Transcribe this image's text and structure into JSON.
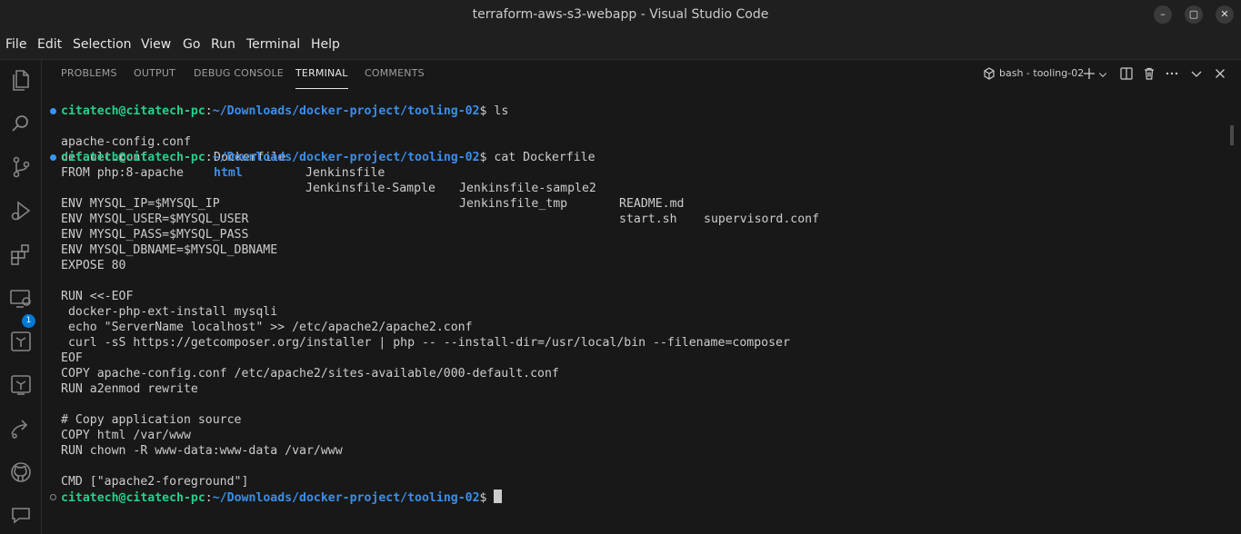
{
  "window": {
    "title": "terraform-aws-s3-webapp - Visual Studio Code",
    "controls": {
      "minimize": "–",
      "maximize": "▢",
      "close": "✕"
    }
  },
  "menu": [
    "File",
    "Edit",
    "Selection",
    "View",
    "Go",
    "Run",
    "Terminal",
    "Help"
  ],
  "activity_bar": {
    "icons": [
      "explorer-icon",
      "search-icon",
      "source-control-icon",
      "run-debug-icon",
      "extensions-icon",
      "remote-explorer-icon",
      "terraform-icon",
      "terraform-cloud-icon",
      "share-icon",
      "github-icon",
      "comments-icon"
    ],
    "extensions_badge": "1"
  },
  "panel": {
    "tabs": [
      "PROBLEMS",
      "OUTPUT",
      "DEBUG CONSOLE",
      "TERMINAL",
      "COMMENTS"
    ],
    "active_tab": "TERMINAL",
    "terminal_name": "bash - tooling-02"
  },
  "terminal": {
    "prompt_user": "citatech@citatech-pc",
    "prompt_path": "~/Downloads/docker-project/tooling-02",
    "commands": [
      "ls",
      "cat Dockerfile"
    ],
    "ls_row1": [
      "apache-config.conf",
      "Dockerfile",
      "Jenkinsfile",
      "Jenkinsfile-sample2",
      "README.md",
      "supervisord.conf"
    ],
    "ls_row2": [
      "default.conf",
      "html",
      "Jenkinsfile-Sample",
      "Jenkinsfile_tmp",
      "start.sh"
    ],
    "dockerfile": [
      "FROM php:8-apache",
      "",
      "ENV MYSQL_IP=$MYSQL_IP",
      "ENV MYSQL_USER=$MYSQL_USER",
      "ENV MYSQL_PASS=$MYSQL_PASS",
      "ENV MYSQL_DBNAME=$MYSQL_DBNAME",
      "EXPOSE 80",
      "",
      "RUN <<-EOF",
      " docker-php-ext-install mysqli",
      " echo \"ServerName localhost\" >> /etc/apache2/apache2.conf",
      " curl -sS https://getcomposer.org/installer | php -- --install-dir=/usr/local/bin --filename=composer",
      "EOF",
      "COPY apache-config.conf /etc/apache2/sites-available/000-default.conf",
      "RUN a2enmod rewrite",
      "",
      "# Copy application source",
      "COPY html /var/www",
      "RUN chown -R www-data:www-data /var/www",
      "",
      "CMD [\"apache2-foreground\"]"
    ]
  }
}
